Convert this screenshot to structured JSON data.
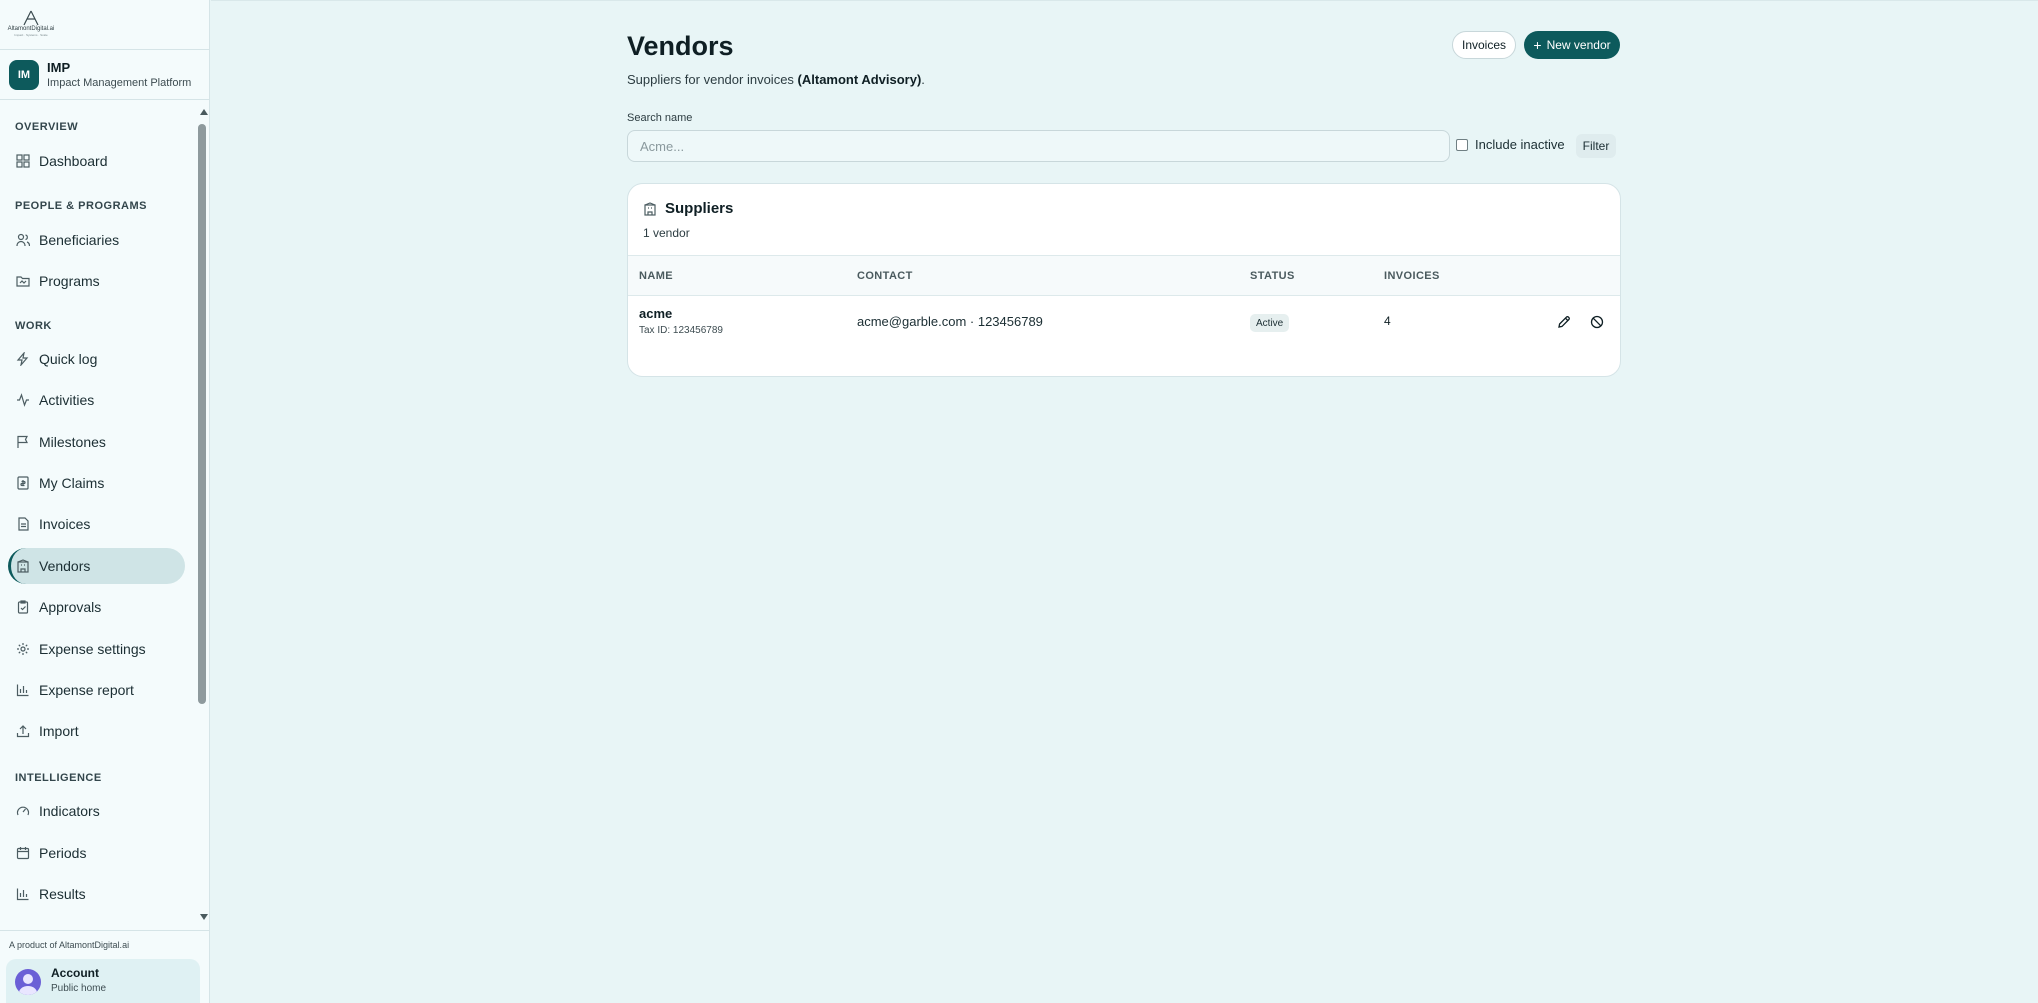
{
  "brand": {
    "logo_text": "AltamontDigital.ai",
    "logo_tagline": "Impact · Systems · Scale"
  },
  "org": {
    "initials": "IM",
    "name": "IMP",
    "subtitle": "Impact Management Platform"
  },
  "sidebar": {
    "sections": [
      {
        "title": "OVERVIEW"
      },
      {
        "title": "PEOPLE & PROGRAMS"
      },
      {
        "title": "WORK"
      },
      {
        "title": "INTELLIGENCE"
      }
    ],
    "items": [
      {
        "label": "Dashboard",
        "icon": "grid-icon"
      },
      {
        "label": "Beneficiaries",
        "icon": "users-icon"
      },
      {
        "label": "Programs",
        "icon": "folder-icon"
      },
      {
        "label": "Quick log",
        "icon": "bolt-icon"
      },
      {
        "label": "Activities",
        "icon": "activity-icon"
      },
      {
        "label": "Milestones",
        "icon": "flag-icon"
      },
      {
        "label": "My Claims",
        "icon": "receipt-icon"
      },
      {
        "label": "Invoices",
        "icon": "file-icon"
      },
      {
        "label": "Vendors",
        "icon": "building-icon",
        "active": true
      },
      {
        "label": "Approvals",
        "icon": "clipboard-icon"
      },
      {
        "label": "Expense settings",
        "icon": "gear-icon"
      },
      {
        "label": "Expense report",
        "icon": "bar-chart-icon"
      },
      {
        "label": "Import",
        "icon": "upload-icon"
      },
      {
        "label": "Indicators",
        "icon": "gauge-icon"
      },
      {
        "label": "Periods",
        "icon": "calendar-icon"
      },
      {
        "label": "Results",
        "icon": "bar-chart-icon"
      }
    ],
    "footer_note": "A product of AltamontDigital.ai",
    "account": {
      "name": "Account",
      "subtitle": "Public home"
    }
  },
  "page": {
    "title": "Vendors",
    "subtitle_prefix": "Suppliers for vendor invoices ",
    "subtitle_org": "(Altamont Advisory)",
    "subtitle_suffix": ".",
    "invoices_button": "Invoices",
    "new_vendor_button": "New vendor"
  },
  "search": {
    "label": "Search name",
    "placeholder": "Acme...",
    "value": "",
    "include_inactive_label": "Include inactive",
    "include_inactive_checked": false,
    "filter_button": "Filter"
  },
  "suppliers": {
    "title": "Suppliers",
    "count_text": "1 vendor",
    "columns": [
      "NAME",
      "CONTACT",
      "STATUS",
      "INVOICES"
    ],
    "rows": [
      {
        "name": "acme",
        "tax_id": "Tax ID: 123456789",
        "contact": "acme@garble.com · 123456789",
        "status": "Active",
        "invoices": "4"
      }
    ]
  },
  "colors": {
    "accent": "#0d5a5c",
    "background": "#e8f5f6",
    "sidebar_bg": "#f4fbfc",
    "active_nav": "#cfe4e6"
  }
}
